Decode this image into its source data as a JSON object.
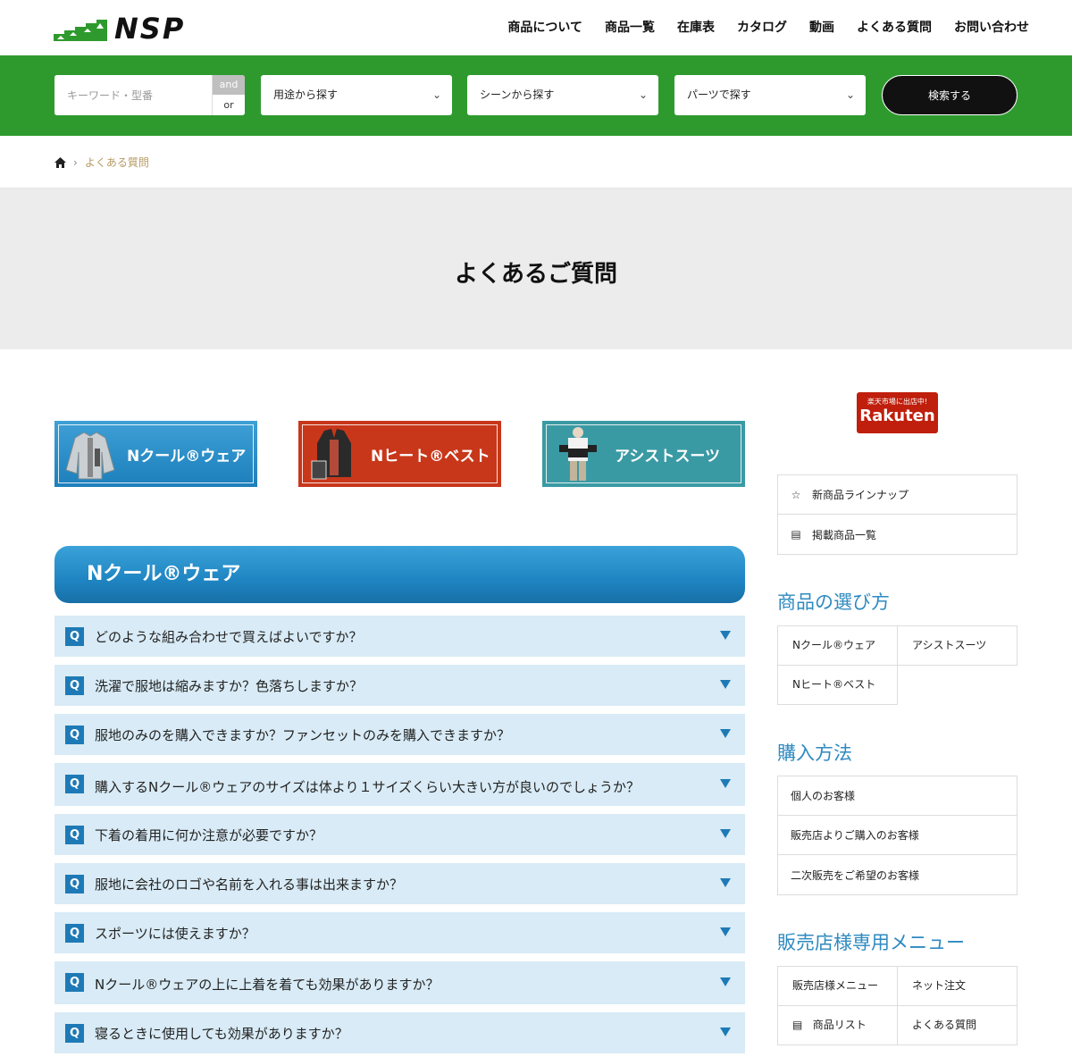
{
  "header": {
    "logo_text": "NSP",
    "nav": [
      "商品について",
      "商品一覧",
      "在庫表",
      "カタログ",
      "動画",
      "よくある質問",
      "お問い合わせ"
    ]
  },
  "search": {
    "keyword_placeholder": "キーワード・型番",
    "and_label": "and",
    "or_label": "or",
    "selects": [
      "用途から探す",
      "シーンから探す",
      "パーツで探す"
    ],
    "button_label": "検索する"
  },
  "breadcrumb": {
    "current": "よくある質問"
  },
  "page_title": "よくあるご質問",
  "banners": [
    "Nクール®ウェア",
    "Nヒート®ベスト",
    "アシストスーツ"
  ],
  "faq_section_title": "Nクール®ウェア",
  "faq_items": [
    "どのような組み合わせで買えばよいですか？",
    "洗濯で服地は縮みますか？色落ちしますか？",
    "服地のみのを購入できますか？ファンセットのみを購入できますか？",
    "購入するNクール®ウェアのサイズは体より１サイズくらい大きい方が良いのでしょうか？",
    "下着の着用に何か注意が必要ですか？",
    "服地に会社のロゴや名前を入れる事は出来ますか？",
    "スポーツには使えますか？",
    "Nクール®ウェアの上に上着を着ても効果がありますか？",
    "寝るときに使用しても効果がありますか？"
  ],
  "faq_q_label": "Q",
  "sidebar": {
    "rakuten_top": "楽天市場に出店中!",
    "rakuten_logo": "Rakuten",
    "links": [
      "新商品ラインナップ",
      "掲載商品一覧"
    ],
    "choose_title": "商品の選び方",
    "choose": [
      "Nクール®ウェア",
      "アシストスーツ",
      "Nヒート®ベスト"
    ],
    "purchase_title": "購入方法",
    "purchase": [
      "個人のお客様",
      "販売店よりご購入のお客様",
      "二次販売をご希望のお客様"
    ],
    "dealer_title": "販売店様専用メニュー",
    "dealer": [
      "販売店様メニュー",
      "ネット注文",
      "商品リスト",
      "よくある質問"
    ]
  },
  "colors": {
    "brand_green": "#2e9a2e",
    "accent_blue": "#1e7ab6",
    "faq_bg": "#d8ebf6"
  }
}
